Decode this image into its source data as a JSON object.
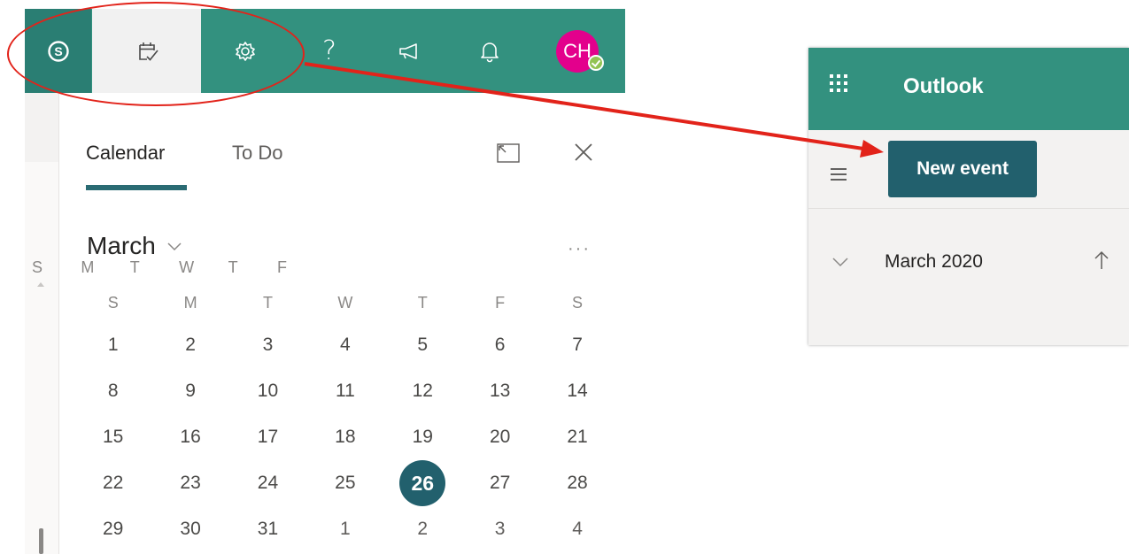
{
  "topbar": {
    "buttons": [
      {
        "name": "skype-icon"
      },
      {
        "name": "calendar-todo-icon"
      },
      {
        "name": "gear-icon"
      },
      {
        "name": "help-icon",
        "label": "?"
      },
      {
        "name": "megaphone-icon"
      },
      {
        "name": "bell-icon"
      }
    ],
    "avatar_initials": "CH",
    "presence": "available"
  },
  "panel": {
    "tabs": [
      "Calendar",
      "To Do"
    ],
    "active_tab": "Calendar",
    "month": "March",
    "more_label": "···",
    "day_headers": [
      "S",
      "M",
      "T",
      "W",
      "T",
      "F",
      "S"
    ],
    "weeks": [
      [
        "1",
        "2",
        "3",
        "4",
        "5",
        "6",
        "7"
      ],
      [
        "8",
        "9",
        "10",
        "11",
        "12",
        "13",
        "14"
      ],
      [
        "15",
        "16",
        "17",
        "18",
        "19",
        "20",
        "21"
      ],
      [
        "22",
        "23",
        "24",
        "25",
        "26",
        "27",
        "28"
      ],
      [
        "29",
        "30",
        "31",
        "1",
        "2",
        "3",
        "4"
      ]
    ],
    "today": "26"
  },
  "outlook": {
    "app_title": "Outlook",
    "new_event_label": "New event",
    "month_label": "March 2020",
    "day_headers": [
      "S",
      "M",
      "T",
      "W",
      "T",
      "F"
    ]
  },
  "colors": {
    "header_teal": "#33917f",
    "accent_dark_teal": "#22606d",
    "avatar_magenta": "#e3008c",
    "annotation_red": "#e2231a"
  }
}
